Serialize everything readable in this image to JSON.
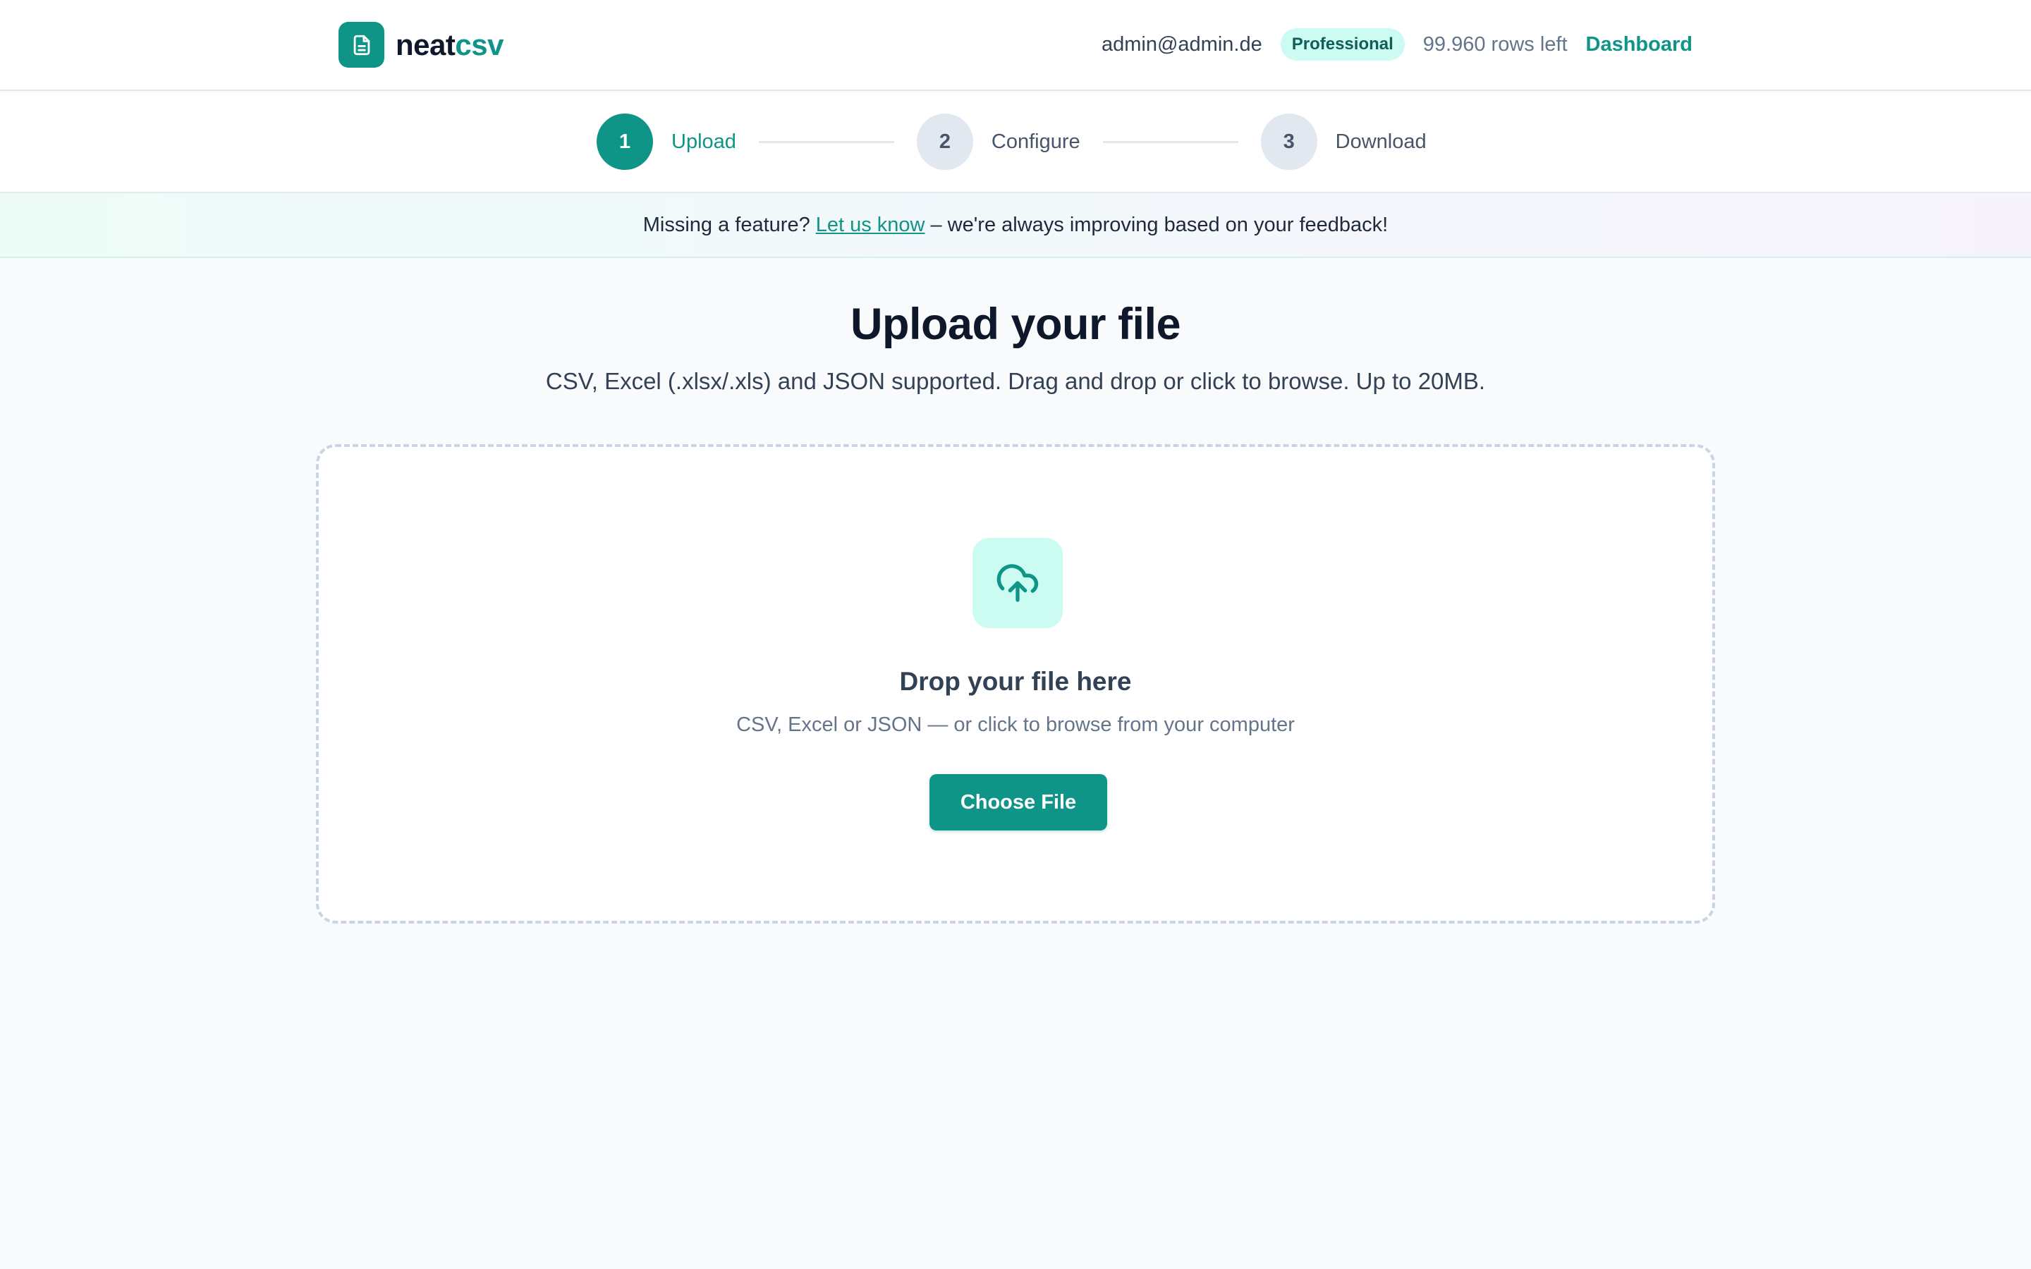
{
  "header": {
    "brand_part1": "neat",
    "brand_part2": "csv",
    "logo_icon": "document-icon",
    "user_email": "admin@admin.de",
    "plan": "Professional",
    "rows_left": "99.960 rows left",
    "dashboard_link": "Dashboard"
  },
  "stepper": {
    "steps": [
      {
        "number": "1",
        "label": "Upload",
        "state": "active"
      },
      {
        "number": "2",
        "label": "Configure",
        "state": "idle"
      },
      {
        "number": "3",
        "label": "Download",
        "state": "idle"
      }
    ]
  },
  "banner": {
    "prefix": "Missing a feature?",
    "link": "Let us know",
    "suffix": "– we're always improving based on your feedback!"
  },
  "main": {
    "title": "Upload your file",
    "subtitle": "CSV, Excel (.xlsx/.xls) and JSON supported. Drag and drop or click to browse. Up to 20MB."
  },
  "dropzone": {
    "icon": "cloud-upload-icon",
    "title": "Drop your file here",
    "subtitle": "CSV, Excel or JSON — or click to browse from your computer",
    "button": "Choose File"
  },
  "colors": {
    "accent": "#0f9488",
    "accent_light": "#ccfbf1",
    "text_dark": "#0f172a",
    "text_muted": "#64748b"
  }
}
